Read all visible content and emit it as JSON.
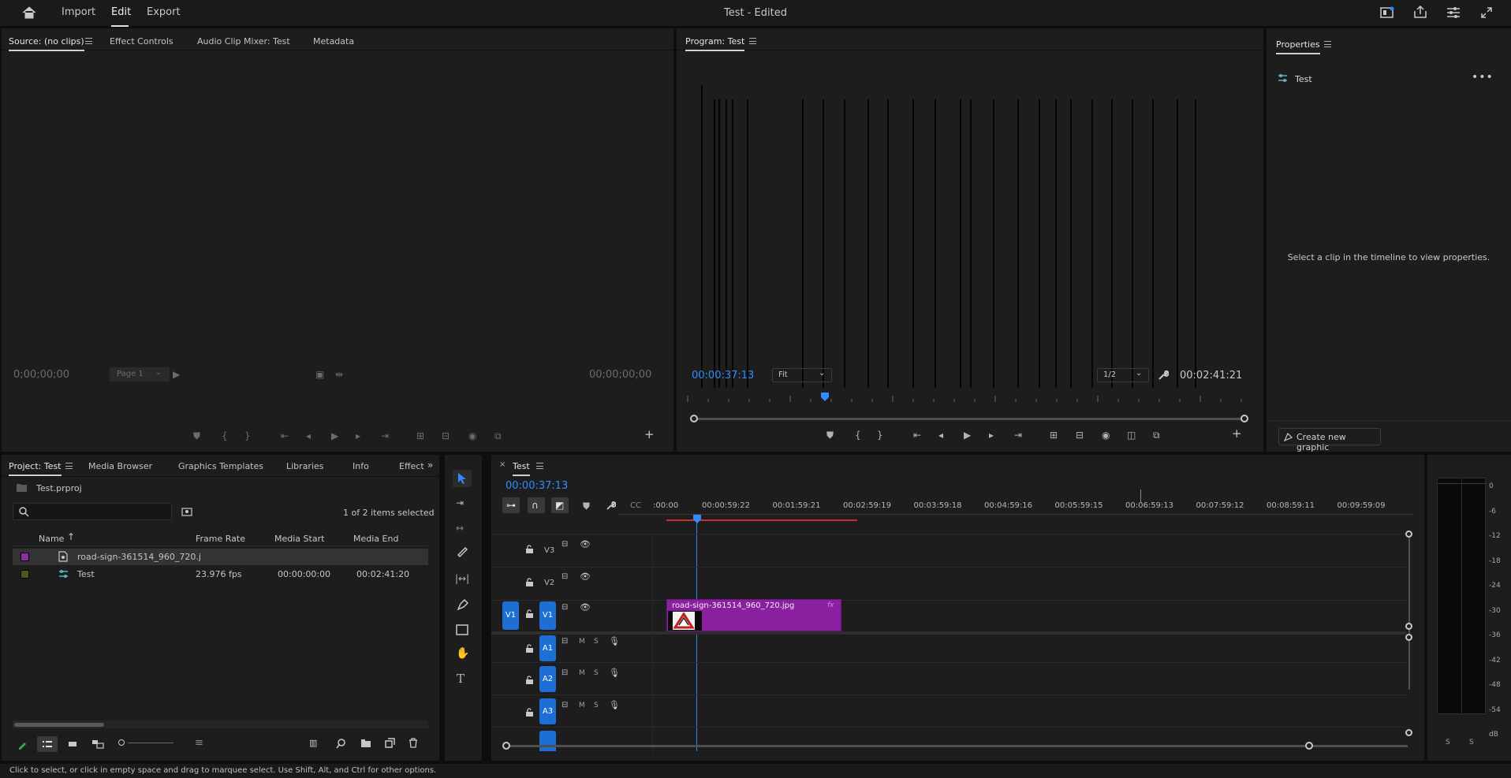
{
  "topbar": {
    "title": "Test - Edited",
    "nav": [
      "Import",
      "Edit",
      "Export"
    ]
  },
  "source_panel": {
    "tabs": [
      "Source: (no clips)",
      "Effect Controls",
      "Audio Clip Mixer: Test",
      "Metadata"
    ],
    "timecode_left": "0;00;00;00",
    "page": "Page 1",
    "timecode_right": "00;00;00;00"
  },
  "program_panel": {
    "tab": "Program: Test",
    "timecode": "00:00:37:13",
    "fit": "Fit",
    "resolution": "1/2",
    "duration": "00:02:41:21"
  },
  "properties_panel": {
    "tab": "Properties",
    "sequence_name": "Test",
    "hint": "Select a clip in the timeline to view properties.",
    "create_button": "Create new graphic"
  },
  "project_panel": {
    "tabs": [
      "Project: Test",
      "Media Browser",
      "Graphics Templates",
      "Libraries",
      "Info",
      "Effects"
    ],
    "project_file": "Test.prproj",
    "search_placeholder": "",
    "selection_count": "1 of 2 items selected",
    "columns": [
      "Name",
      "Frame Rate",
      "Media Start",
      "Media End"
    ],
    "rows": [
      {
        "name": "road-sign-361514_960_720.j",
        "frame_rate": "",
        "media_start": "",
        "media_end": "",
        "color": "#8a2fa6"
      },
      {
        "name": "Test",
        "frame_rate": "23.976 fps",
        "media_start": "00:00:00:00",
        "media_end": "00:02:41:20",
        "color": "#4a5a1a"
      }
    ]
  },
  "timeline": {
    "tab": "Test",
    "timecode": "00:00:37:13",
    "ruler": [
      ":00:00",
      "00:00:59:22",
      "00:01:59:21",
      "00:02:59:19",
      "00:03:59:18",
      "00:04:59:16",
      "00:05:59:15",
      "00:06:59:13",
      "00:07:59:12",
      "00:08:59:11",
      "00:09:59:09"
    ],
    "video_tracks": [
      "V3",
      "V2",
      "V1"
    ],
    "source_patch": "V1",
    "audio_tracks": [
      "A1",
      "A2",
      "A3"
    ],
    "track_m": "M",
    "track_s": "S",
    "clip_name": "road-sign-361514_960_720.jpg",
    "clip_fx": "fx"
  },
  "audio_meter": {
    "scale": [
      "0",
      "-6",
      "-12",
      "-18",
      "-24",
      "-30",
      "-36",
      "-42",
      "-48",
      "-54",
      "dB"
    ],
    "solo": [
      "S",
      "S"
    ]
  },
  "status_bar": "Click to select, or click in empty space and drag to marquee select. Use Shift, Alt, and Ctrl for other options."
}
